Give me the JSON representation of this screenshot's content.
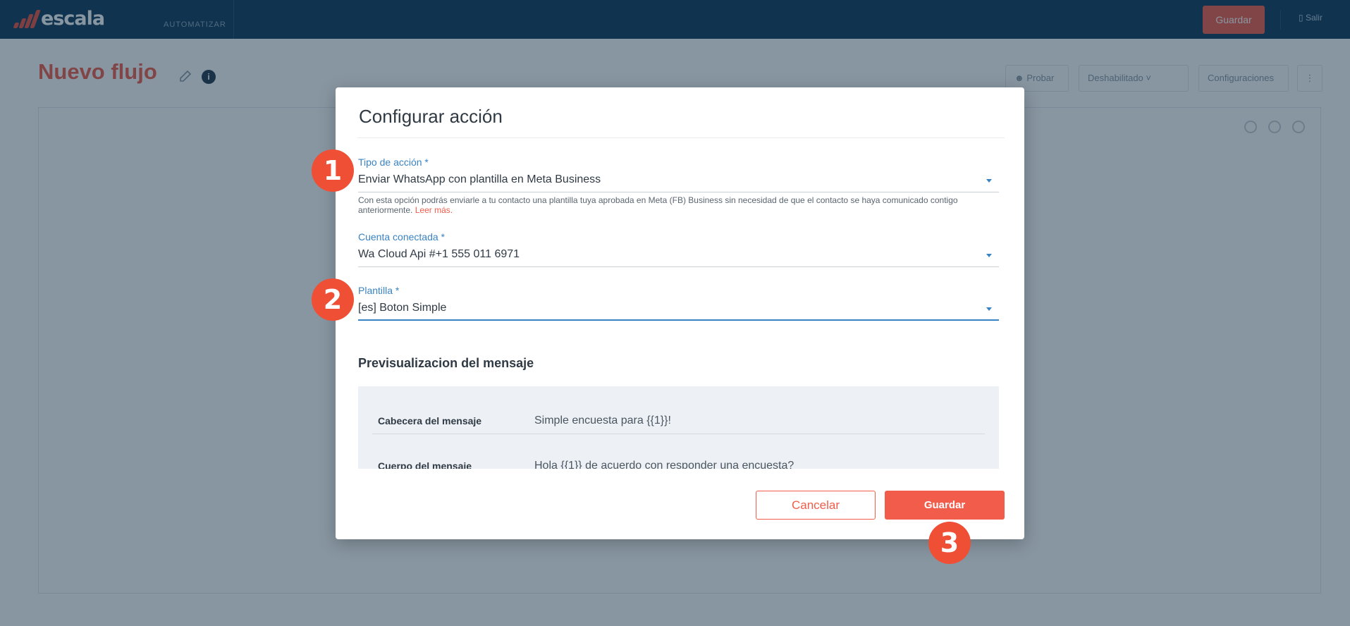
{
  "app": {
    "logo_text": "escala",
    "nav_item": "AUTOMATIZAR",
    "top_save": "Guardar",
    "top_exit": "Salir"
  },
  "page": {
    "title": "Nuevo flujo",
    "info_glyph": "i",
    "buttons": {
      "test": "Probar",
      "status": "Deshabilitado",
      "settings": "Configuraciones"
    }
  },
  "modal": {
    "title": "Configurar acción",
    "action_type": {
      "label": "Tipo de acción *",
      "value": "Enviar WhatsApp con plantilla en Meta Business",
      "help": "Con esta opción podrás enviarle a tu contacto una plantilla tuya aprobada en Meta (FB) Business sin necesidad de que el contacto se haya comunicado contigo anteriormente.",
      "help_link": "Leer más."
    },
    "account": {
      "label": "Cuenta conectada *",
      "value": "Wa Cloud Api #+1 555 011 6971"
    },
    "template": {
      "label": "Plantilla *",
      "value": "[es] Boton Simple"
    },
    "preview": {
      "title": "Previsualizacion del mensaje",
      "rows": [
        {
          "key": "Cabecera del mensaje",
          "value": "Simple encuesta para {{1}}!"
        },
        {
          "key": "Cuerpo del mensaje",
          "value": "Hola {{1}} de acuerdo con responder una encuesta?"
        }
      ]
    },
    "cancel_label": "Cancelar",
    "save_label": "Guardar"
  },
  "markers": [
    "1",
    "2",
    "3"
  ],
  "colors": {
    "accent": "#f25c4a",
    "topbar": "#0e3a5c",
    "focus": "#3a83c2",
    "marker": "#ee4f35"
  },
  "icons": [
    "escala-logo-icon",
    "edit-pencil-icon",
    "info-icon",
    "caret-down-icon",
    "user-icon",
    "more-vertical-icon",
    "exit-icon"
  ]
}
